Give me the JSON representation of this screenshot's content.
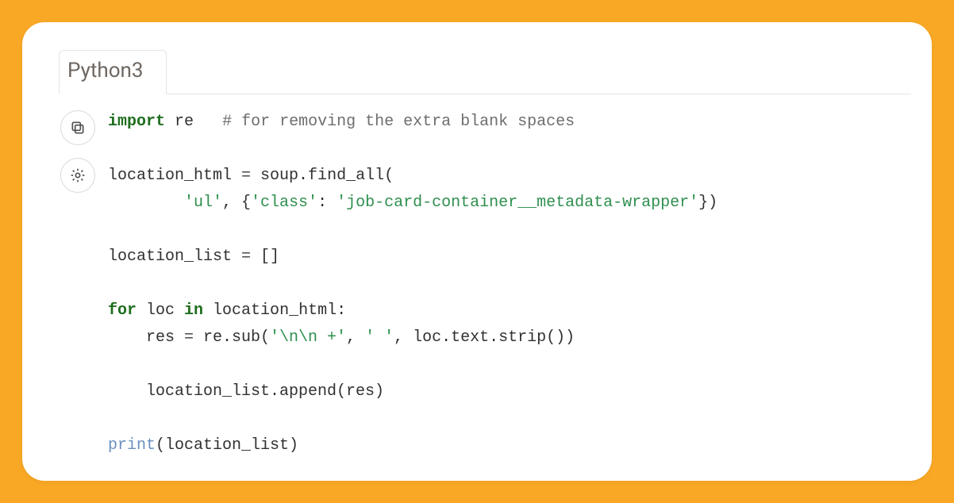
{
  "tab": {
    "label": "Python3"
  },
  "actions": {
    "copy_tooltip": "Copy",
    "toggle_tooltip": "Toggle brightness"
  },
  "code": {
    "l1": {
      "kw": "import",
      "mod": "re",
      "cmt": "# for removing the extra blank spaces"
    },
    "l3a": "location_html ",
    "l3b": " soup.find_all(",
    "l4a": "        ",
    "l4_s1": "'ul'",
    "l4b": ", {",
    "l4_s2": "'class'",
    "l4c": ": ",
    "l4_s3": "'job-card-container__metadata-wrapper'",
    "l4d": "})",
    "l6a": "location_list ",
    "l6b": " []",
    "l8a": "for",
    "l8b": " loc ",
    "l8c": "in",
    "l8d": " location_html:",
    "l9a": "    res ",
    "l9b": " re.sub(",
    "l9_s1": "'\\n\\n +'",
    "l9c": ", ",
    "l9_s2": "' '",
    "l9d": ", loc.text.strip())",
    "l11": "    location_list.append(res)",
    "l13a": "print",
    "l13b": "(location_list)",
    "eq": "="
  }
}
